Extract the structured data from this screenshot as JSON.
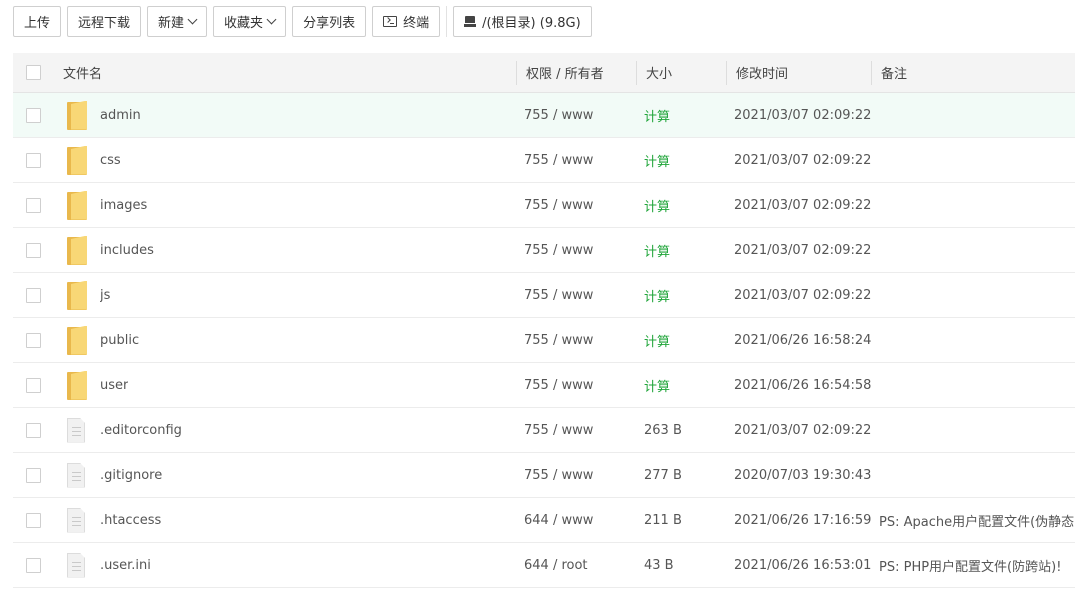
{
  "toolbar": {
    "upload": "上传",
    "remote_download": "远程下载",
    "new": "新建",
    "favorites": "收藏夹",
    "share_list": "分享列表",
    "terminal": "终端",
    "path": "/(根目录) (9.8G)"
  },
  "table": {
    "headers": {
      "name": "文件名",
      "perm": "权限 / 所有者",
      "size": "大小",
      "mtime": "修改时间",
      "note": "备注"
    },
    "rows": [
      {
        "type": "folder",
        "name": "admin",
        "perm": "755 / www",
        "size": "计算",
        "mtime": "2021/03/07 02:09:22",
        "note": ""
      },
      {
        "type": "folder",
        "name": "css",
        "perm": "755 / www",
        "size": "计算",
        "mtime": "2021/03/07 02:09:22",
        "note": ""
      },
      {
        "type": "folder",
        "name": "images",
        "perm": "755 / www",
        "size": "计算",
        "mtime": "2021/03/07 02:09:22",
        "note": ""
      },
      {
        "type": "folder",
        "name": "includes",
        "perm": "755 / www",
        "size": "计算",
        "mtime": "2021/03/07 02:09:22",
        "note": ""
      },
      {
        "type": "folder",
        "name": "js",
        "perm": "755 / www",
        "size": "计算",
        "mtime": "2021/03/07 02:09:22",
        "note": ""
      },
      {
        "type": "folder",
        "name": "public",
        "perm": "755 / www",
        "size": "计算",
        "mtime": "2021/06/26 16:58:24",
        "note": ""
      },
      {
        "type": "folder",
        "name": "user",
        "perm": "755 / www",
        "size": "计算",
        "mtime": "2021/06/26 16:54:58",
        "note": ""
      },
      {
        "type": "file",
        "name": ".editorconfig",
        "perm": "755 / www",
        "size": "263 B",
        "mtime": "2021/03/07 02:09:22",
        "note": ""
      },
      {
        "type": "file",
        "name": ".gitignore",
        "perm": "755 / www",
        "size": "277 B",
        "mtime": "2020/07/03 19:30:43",
        "note": ""
      },
      {
        "type": "file",
        "name": ".htaccess",
        "perm": "644 / www",
        "size": "211 B",
        "mtime": "2021/06/26 17:16:59",
        "note": "PS: Apache用户配置文件(伪静态)"
      },
      {
        "type": "file",
        "name": ".user.ini",
        "perm": "644 / root",
        "size": "43 B",
        "mtime": "2021/06/26 16:53:01",
        "note": "PS: PHP用户配置文件(防跨站)!"
      }
    ]
  },
  "colors": {
    "calc_link": "#20a53a",
    "selected_row_bg": "#f2fbf7",
    "folder_front": "#f8d776",
    "folder_back": "#e9b84c"
  },
  "icons": {
    "folder": "folder-icon",
    "file": "file-icon",
    "terminal": "terminal-icon",
    "disk": "disk-icon",
    "dropdown": "chevron-down-icon"
  }
}
